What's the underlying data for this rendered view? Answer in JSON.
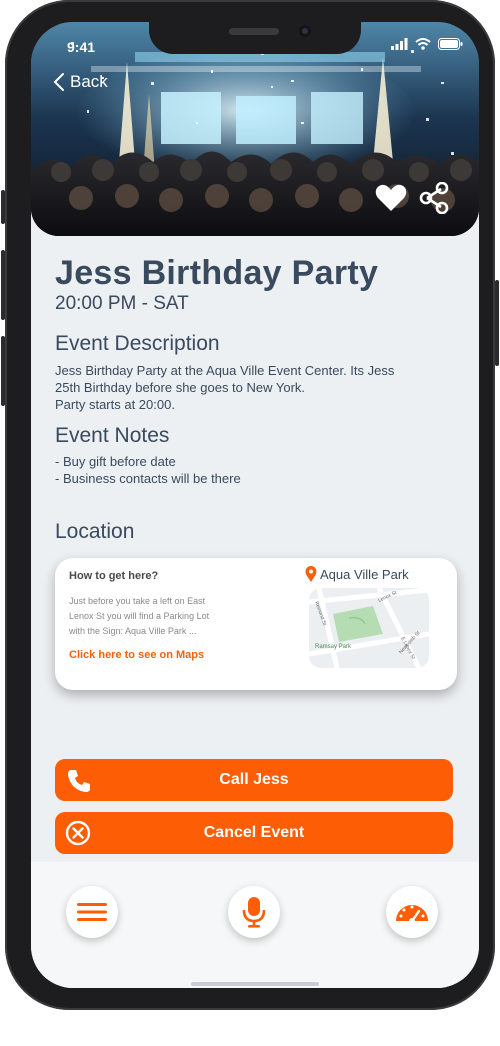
{
  "status_bar": {
    "time": "9:41"
  },
  "nav": {
    "back_label": "Back"
  },
  "event": {
    "title": "Jess Birthday Party",
    "datetime": "20:00 PM - SAT",
    "description_heading": "Event Description",
    "description_lines": [
      "Jess Birthday Party at the Aqua Ville Event Center. Its Jess",
      "25th Birthday before she goes to New York.",
      "Party starts at 20:00."
    ],
    "notes_heading": "Event Notes",
    "notes": [
      "- Buy gift before date",
      "- Business contacts will be there"
    ]
  },
  "location": {
    "heading": "Location",
    "how_to_heading": "How to get here?",
    "directions_lines": [
      "Just before you take a left on East",
      "Lenox St you will find a Parking Lot",
      "with the Sign: Aqua Ville Park ..."
    ],
    "maps_link": "Click here to see on Maps",
    "place_name": "Aqua Ville Park",
    "map_labels": {
      "street_1": "Lenox St",
      "street_2": "E Lenox St",
      "street_3": "Remond St",
      "street_4": "Newcomb St",
      "park": "Ramsay Park"
    }
  },
  "actions": {
    "call_label": "Call Jess",
    "cancel_label": "Cancel Event"
  },
  "tabbar": {
    "icons": [
      "menu-icon",
      "microphone-icon",
      "speedometer-icon"
    ]
  },
  "colors": {
    "accent": "#fd5d05",
    "text": "#394a5e",
    "background": "#edf0f3"
  }
}
